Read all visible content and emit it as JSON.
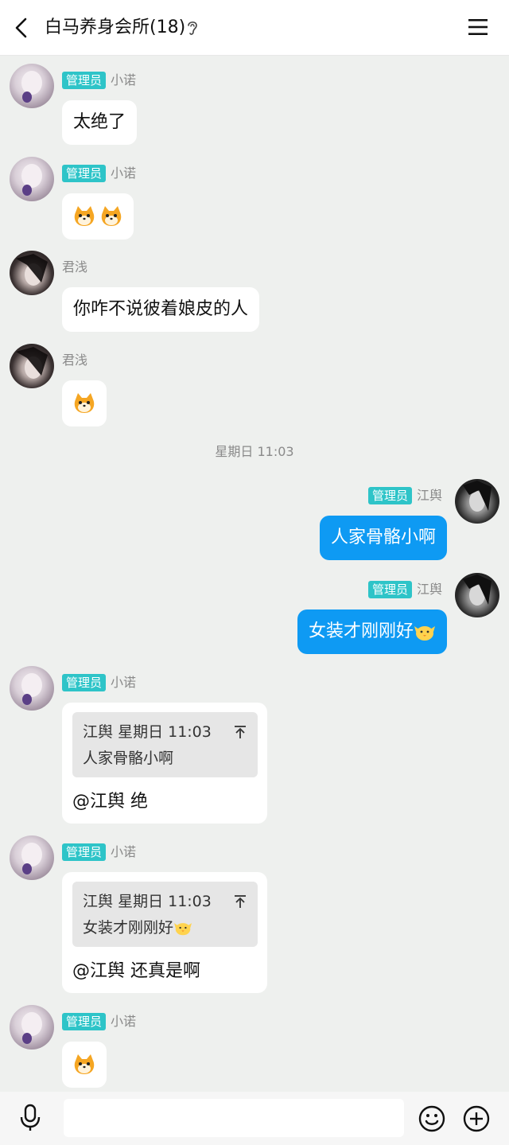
{
  "header": {
    "title": "白马养身会所(18)",
    "back_icon": "chevron-left-icon",
    "ear_icon": "ear-icon",
    "menu_icon": "menu-icon"
  },
  "messages": [
    {
      "sender": "小诺",
      "badge": "管理员",
      "text": "太绝了",
      "side": "left"
    },
    {
      "sender": "小诺",
      "badge": "管理员",
      "emoji": [
        "shiba-emoji",
        "shiba-emoji"
      ],
      "side": "left"
    },
    {
      "sender": "君浅",
      "text": "你咋不说彼着娘皮的人",
      "side": "left"
    },
    {
      "sender": "君浅",
      "emoji": [
        "shiba-emoji"
      ],
      "side": "left"
    },
    {
      "time_separator": "星期日 11:03"
    },
    {
      "sender": "江舆",
      "badge": "管理员",
      "text": "人家骨骼小啊",
      "side": "right"
    },
    {
      "sender": "江舆",
      "badge": "管理员",
      "text": "女装才刚刚好",
      "trailing_emoji": "chick-emoji",
      "side": "right"
    },
    {
      "sender": "小诺",
      "badge": "管理员",
      "side": "left",
      "quote": {
        "author": "江舆",
        "time": "星期日 11:03",
        "text": "人家骨骼小啊"
      },
      "text": "@江舆 绝"
    },
    {
      "sender": "小诺",
      "badge": "管理员",
      "side": "left",
      "quote": {
        "author": "江舆",
        "time": "星期日 11:03",
        "text": "女装才刚刚好",
        "trailing_emoji": "chick-emoji"
      },
      "text": "@江舆 还真是啊"
    },
    {
      "sender": "小诺",
      "badge": "管理员",
      "emoji": [
        "shiba-emoji"
      ],
      "side": "left"
    }
  ],
  "input_bar": {
    "placeholder": "",
    "icons": [
      "microphone-icon",
      "smiley-icon",
      "plus-icon"
    ]
  },
  "colors": {
    "background": "#eef0ee",
    "badge": "#2ec4c8",
    "self_bubble": "#0e9af3"
  }
}
